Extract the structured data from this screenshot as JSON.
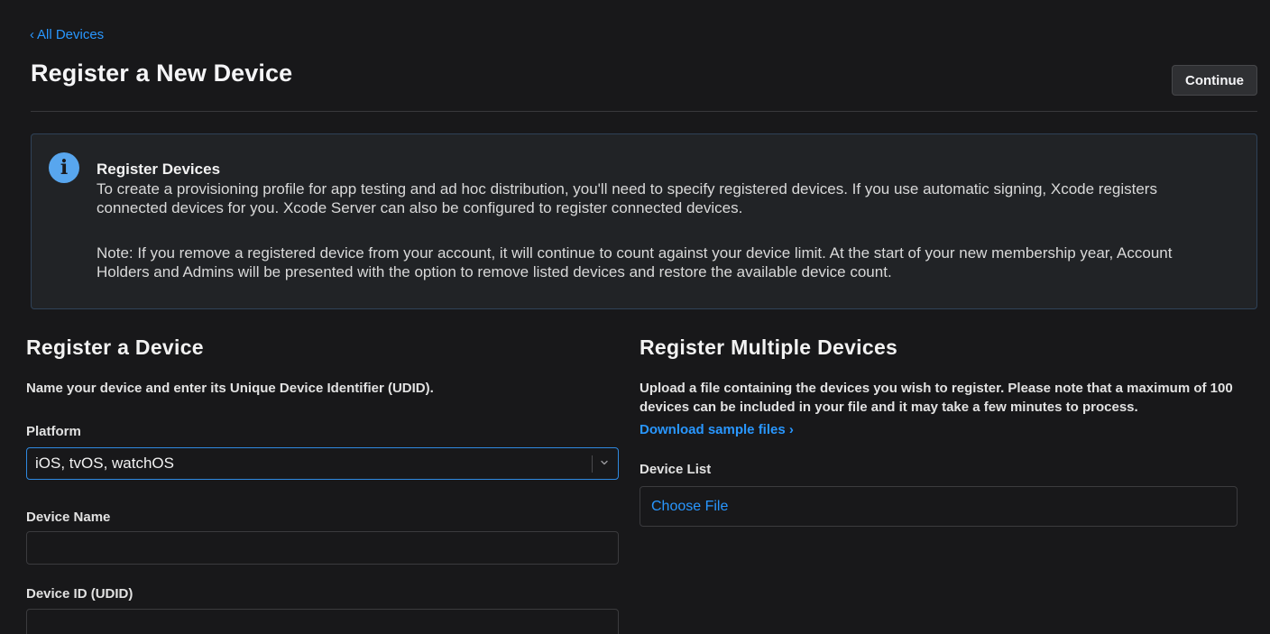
{
  "nav": {
    "back_label": "All Devices",
    "back_chevron": "‹"
  },
  "header": {
    "title": "Register a New Device",
    "continue_label": "Continue"
  },
  "info": {
    "icon": "info-icon",
    "icon_glyph": "i",
    "title": "Register Devices",
    "paragraph1": "To create a provisioning profile for app testing and ad hoc distribution, you'll need to specify registered devices. If you use automatic signing, Xcode registers connected devices for you. Xcode Server can also be configured to register connected devices.",
    "paragraph2": "Note: If you remove a registered device from your account, it will continue to count against your device limit. At the start of your new membership year, Account Holders and Admins will be presented with the option to remove listed devices and restore the available device count."
  },
  "single": {
    "title": "Register a Device",
    "description": "Name your device and enter its Unique Device Identifier (UDID).",
    "platform_label": "Platform",
    "platform_value": "iOS, tvOS, watchOS",
    "device_name_label": "Device Name",
    "device_name_value": "",
    "device_id_label": "Device ID (UDID)",
    "device_id_value": ""
  },
  "multiple": {
    "title": "Register Multiple Devices",
    "description": "Upload a file containing the devices you wish to register. Please note that a maximum of 100 devices can be included in your file and it may take a few minutes to process.",
    "sample_link": "Download sample files ›",
    "device_list_label": "Device List",
    "choose_file_label": "Choose File"
  },
  "colors": {
    "background": "#18181a",
    "link": "#2997ff",
    "focus_border": "#2f89e0",
    "info_icon": "#58a6ee"
  }
}
